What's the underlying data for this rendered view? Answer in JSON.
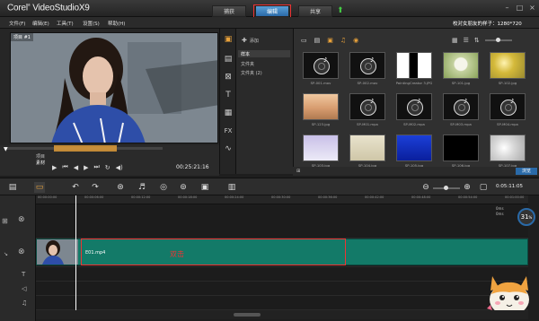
{
  "window": {
    "title_main": "Corel",
    "title_product": "VideoStudio",
    "title_version": "X9"
  },
  "tabs": [
    {
      "label": "捕获"
    },
    {
      "label": "编辑"
    },
    {
      "label": "共享"
    }
  ],
  "menu": [
    {
      "label": "文件(F)"
    },
    {
      "label": "编辑(E)"
    },
    {
      "label": "工具(T)"
    },
    {
      "label": "设置(S)"
    },
    {
      "label": "帮助(H)"
    }
  ],
  "project_info": "校对女朋友的样子：1280*720",
  "preview": {
    "overlay_label": "项目 #1"
  },
  "transport": {
    "mode_project": "项目",
    "mode_clip": "素材",
    "timecode": "00:25:21:16"
  },
  "folders": {
    "add_label": "添加",
    "items": [
      {
        "label": "样本"
      },
      {
        "label": "文件夹"
      },
      {
        "label": "文件夹 (2)"
      }
    ]
  },
  "library": {
    "thumbs": [
      {
        "caption": "SP-001.mov",
        "kind": "audio"
      },
      {
        "caption": "SP-002.mov",
        "kind": "audio"
      },
      {
        "caption": "PaintingCreator 3.JPG",
        "kind": "paint"
      },
      {
        "caption": "SP-101.jpg",
        "kind": "dandelion"
      },
      {
        "caption": "SP-102.jpg",
        "kind": "yellow"
      },
      {
        "caption": "SP-123.jpg",
        "kind": "desert"
      },
      {
        "caption": "SP-M01.mpa",
        "kind": "audio"
      },
      {
        "caption": "SP-M02.mpa",
        "kind": "audio"
      },
      {
        "caption": "SP-M03.mpa",
        "kind": "audio"
      },
      {
        "caption": "SP-M04.mpa",
        "kind": "audio"
      },
      {
        "caption": "SP-103.jpg",
        "kind": "snow"
      },
      {
        "caption": "SP-104.jpg",
        "kind": "paper"
      },
      {
        "caption": "SP-105.jpg",
        "kind": "blue"
      },
      {
        "caption": "SP-106.jpg",
        "kind": "black"
      },
      {
        "caption": "SP-107.jpg",
        "kind": "sparkle"
      }
    ],
    "browse_label": "浏览"
  },
  "timeline": {
    "timecode": "0:05:11:05",
    "ruler_ticks": [
      "00:00:00:00",
      "00:00:06:00",
      "00:00:12:00",
      "00:00:18:00",
      "00:00:24:00",
      "00:00:30:00",
      "00:00:36:00",
      "00:00:42:00",
      "00:00:48:00",
      "00:00:54:00",
      "00:01:00:00"
    ],
    "clip_name": "E01.mp4",
    "clip_annotation": "双击",
    "zoom_percent": "31",
    "side_labels": [
      "0ms",
      "0ms"
    ]
  }
}
